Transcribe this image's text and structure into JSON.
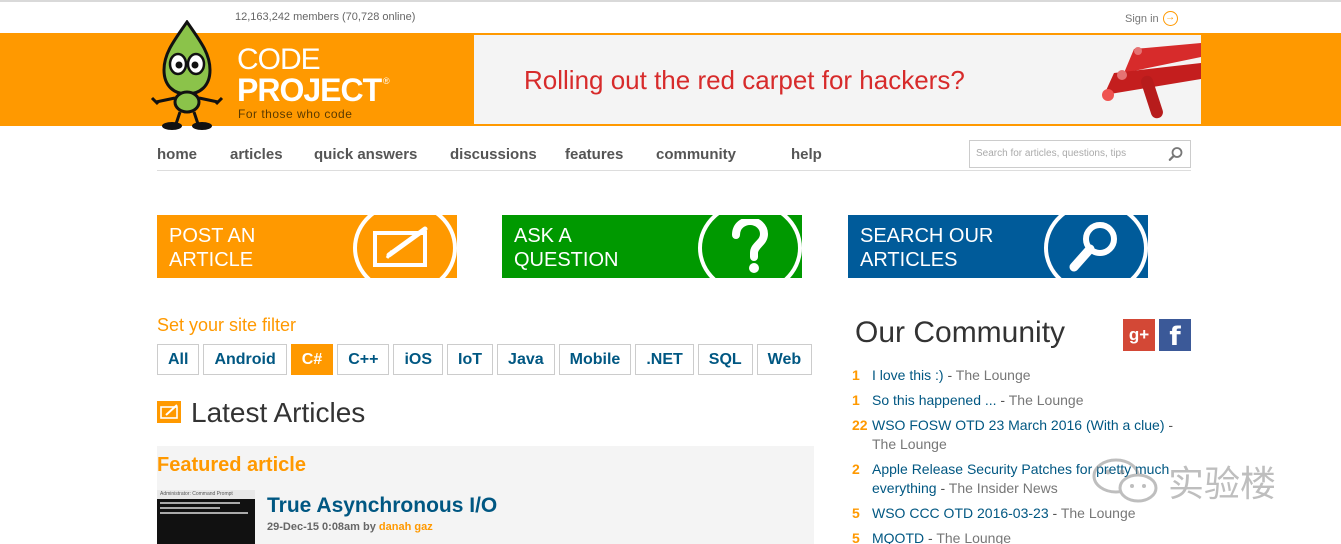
{
  "topbar": {
    "members": "12,163,242 members (70,728 online)",
    "signin": "Sign in",
    "signin_arrow": "→"
  },
  "logo": {
    "code": "CODE",
    "project": "PROJECT",
    "registered": "®",
    "tagline": "For those who code"
  },
  "banner": {
    "text": "Rolling out the red carpet for hackers?"
  },
  "nav": {
    "items": [
      "home",
      "articles",
      "quick answers",
      "discussions",
      "features",
      "community",
      "help"
    ]
  },
  "search": {
    "placeholder": "Search for articles, questions, tips",
    "icon": "magnifier-icon"
  },
  "tiles": [
    {
      "line1": "POST AN",
      "line2": "ARTICLE",
      "color": "#ff9900",
      "icon": "edit-icon"
    },
    {
      "line1": "ASK A",
      "line2": "QUESTION",
      "color": "#009900",
      "icon": "question-icon"
    },
    {
      "line1": "SEARCH OUR",
      "line2": "ARTICLES",
      "color": "#005b9a",
      "icon": "search-icon"
    }
  ],
  "filter": {
    "label": "Set your site filter",
    "options": [
      "All",
      "Android",
      "C#",
      "C++",
      "iOS",
      "IoT",
      "Java",
      "Mobile",
      ".NET",
      "SQL",
      "Web"
    ],
    "selected": "C#"
  },
  "latest": {
    "title": "Latest Articles",
    "featured_label": "Featured article",
    "article_title": "True Asynchronous I/O",
    "date": "29-Dec-15 0:08am",
    "by": "by",
    "author": "danah gaz",
    "thumb_caption": "Administrator: Command Prompt"
  },
  "community": {
    "title": "Our Community",
    "gplus": "g+",
    "fb": "f",
    "items": [
      {
        "count": "1",
        "title": "I love this :)",
        "sep": " - ",
        "forum": "The Lounge"
      },
      {
        "count": "1",
        "title": "So this happened ...",
        "sep": " - ",
        "forum": "The Lounge"
      },
      {
        "count": "22",
        "title": "WSO FOSW OTD 23 March 2016 (With a clue)",
        "sep": " - ",
        "forum": "The Lounge"
      },
      {
        "count": "2",
        "title": "Apple Release Security Patches for pretty much everything",
        "sep": " - ",
        "forum": "The Insider News"
      },
      {
        "count": "5",
        "title": "WSO CCC OTD 2016-03-23",
        "sep": " - ",
        "forum": "The Lounge"
      },
      {
        "count": "5",
        "title": "MQOTD",
        "sep": " - ",
        "forum": "The Lounge"
      }
    ]
  },
  "watermark": {
    "text": "实验楼"
  },
  "colors": {
    "brand_orange": "#ff9900",
    "link_blue": "#005782",
    "banner_red": "#d72b2b"
  }
}
